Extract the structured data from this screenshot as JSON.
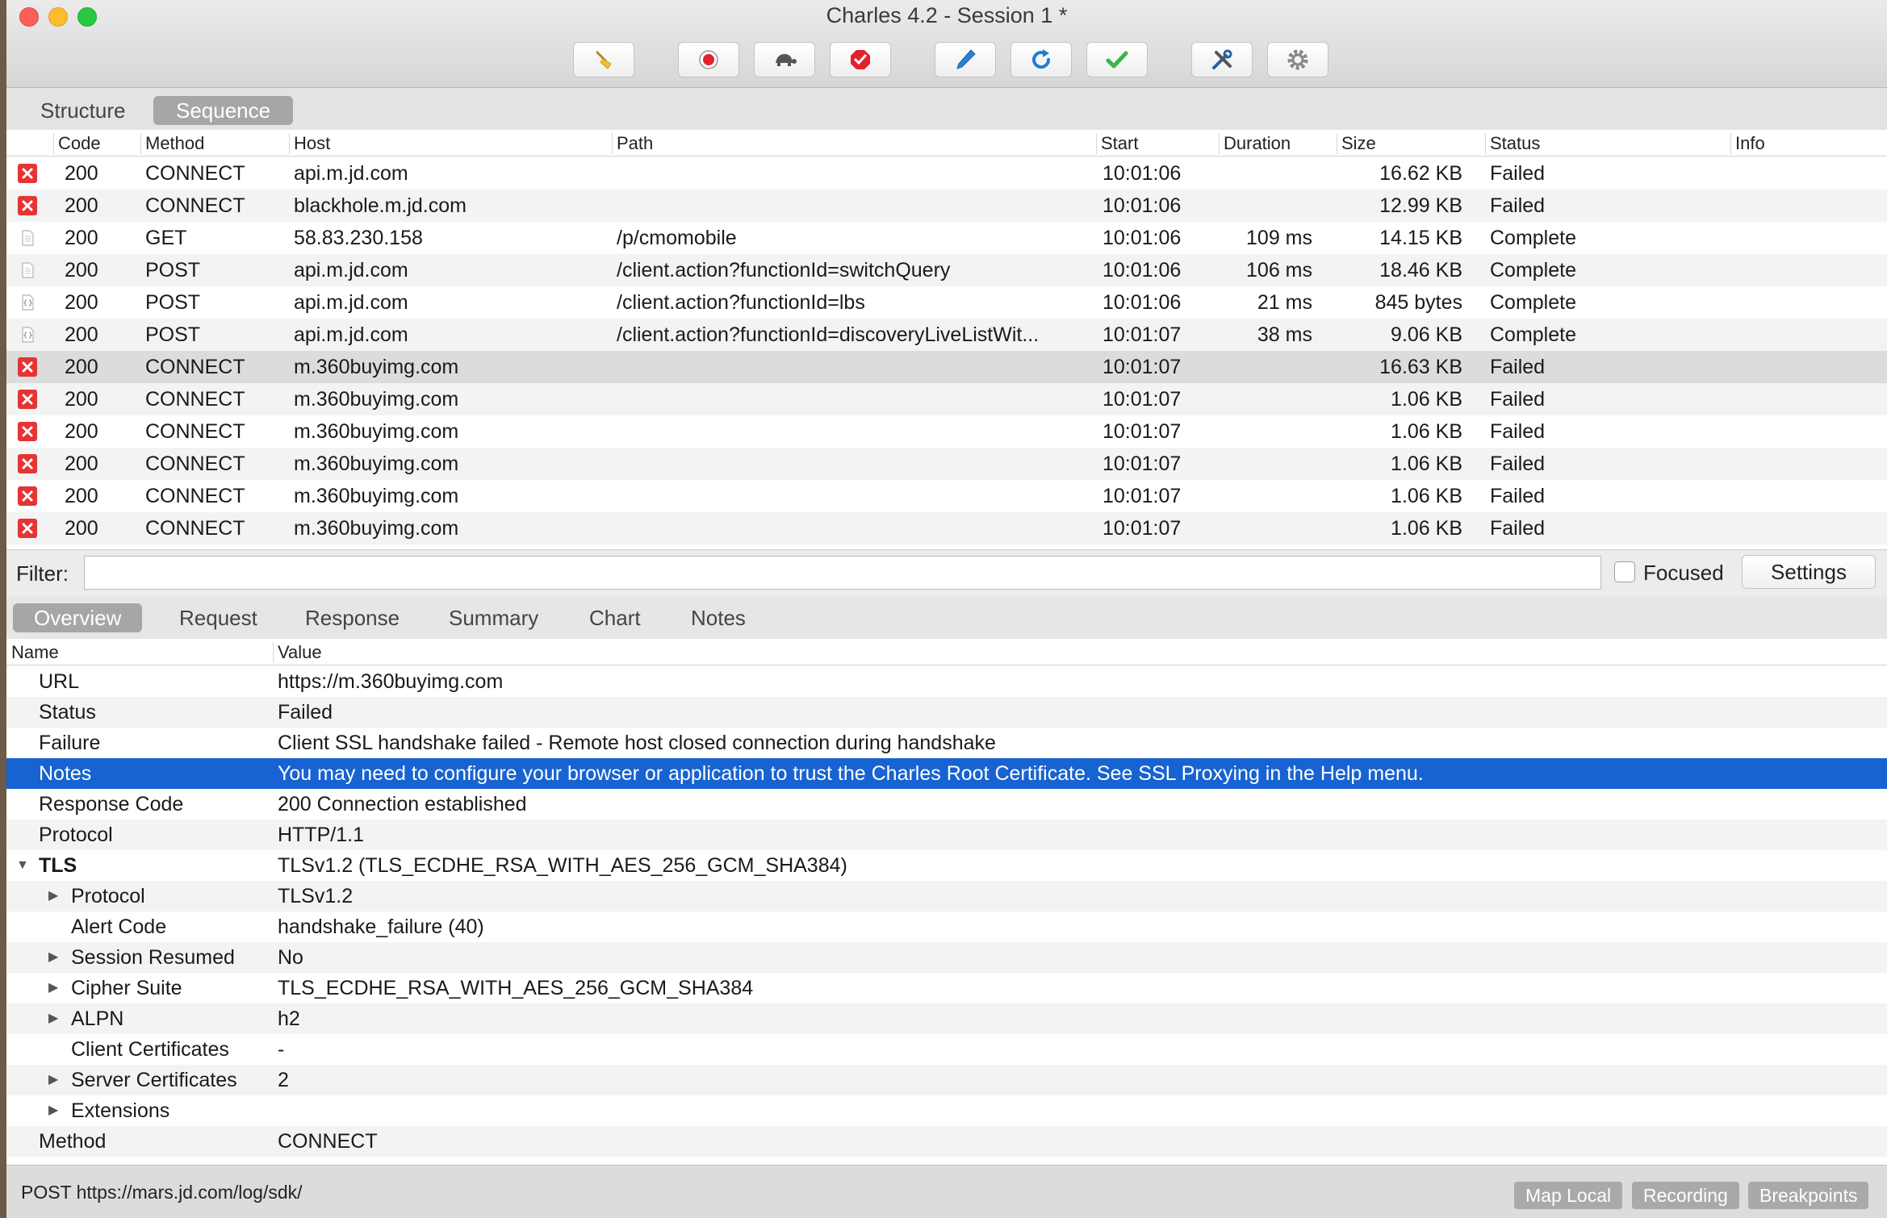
{
  "window": {
    "title": "Charles 4.2 - Session 1 *"
  },
  "toolbar": {
    "buttons": [
      {
        "icon": "broom-icon"
      },
      {
        "icon": "record-icon"
      },
      {
        "icon": "turtle-icon"
      },
      {
        "icon": "breakpoint-icon"
      },
      {
        "icon": "compose-pen-icon"
      },
      {
        "icon": "repeat-icon"
      },
      {
        "icon": "validate-checkmark-icon"
      },
      {
        "icon": "tools-icon"
      },
      {
        "icon": "gear-icon"
      }
    ]
  },
  "view_tabs": [
    {
      "label": "Structure",
      "active": false
    },
    {
      "label": "Sequence",
      "active": true
    }
  ],
  "sessions": {
    "columns": [
      "Code",
      "Method",
      "Host",
      "Path",
      "Start",
      "Duration",
      "Size",
      "Status",
      "Info"
    ],
    "rows": [
      {
        "icon": "failed",
        "code": "200",
        "method": "CONNECT",
        "host": "api.m.jd.com",
        "path": "",
        "start": "10:01:06",
        "duration": "",
        "size": "16.62 KB",
        "status": "Failed",
        "info": ""
      },
      {
        "icon": "failed",
        "code": "200",
        "method": "CONNECT",
        "host": "blackhole.m.jd.com",
        "path": "",
        "start": "10:01:06",
        "duration": "",
        "size": "12.99 KB",
        "status": "Failed",
        "info": ""
      },
      {
        "icon": "doc",
        "code": "200",
        "method": "GET",
        "host": "58.83.230.158",
        "path": "/p/cmomobile",
        "start": "10:01:06",
        "duration": "109 ms",
        "size": "14.15 KB",
        "status": "Complete",
        "info": ""
      },
      {
        "icon": "doc",
        "code": "200",
        "method": "POST",
        "host": "api.m.jd.com",
        "path": "/client.action?functionId=switchQuery",
        "start": "10:01:06",
        "duration": "106 ms",
        "size": "18.46 KB",
        "status": "Complete",
        "info": ""
      },
      {
        "icon": "json",
        "code": "200",
        "method": "POST",
        "host": "api.m.jd.com",
        "path": "/client.action?functionId=lbs",
        "start": "10:01:06",
        "duration": "21 ms",
        "size": "845 bytes",
        "status": "Complete",
        "info": ""
      },
      {
        "icon": "json",
        "code": "200",
        "method": "POST",
        "host": "api.m.jd.com",
        "path": "/client.action?functionId=discoveryLiveListWit...",
        "start": "10:01:07",
        "duration": "38 ms",
        "size": "9.06 KB",
        "status": "Complete",
        "info": ""
      },
      {
        "icon": "failed",
        "code": "200",
        "method": "CONNECT",
        "host": "m.360buyimg.com",
        "path": "",
        "start": "10:01:07",
        "duration": "",
        "size": "16.63 KB",
        "status": "Failed",
        "info": "",
        "selected": true
      },
      {
        "icon": "failed",
        "code": "200",
        "method": "CONNECT",
        "host": "m.360buyimg.com",
        "path": "",
        "start": "10:01:07",
        "duration": "",
        "size": "1.06 KB",
        "status": "Failed",
        "info": ""
      },
      {
        "icon": "failed",
        "code": "200",
        "method": "CONNECT",
        "host": "m.360buyimg.com",
        "path": "",
        "start": "10:01:07",
        "duration": "",
        "size": "1.06 KB",
        "status": "Failed",
        "info": ""
      },
      {
        "icon": "failed",
        "code": "200",
        "method": "CONNECT",
        "host": "m.360buyimg.com",
        "path": "",
        "start": "10:01:07",
        "duration": "",
        "size": "1.06 KB",
        "status": "Failed",
        "info": ""
      },
      {
        "icon": "failed",
        "code": "200",
        "method": "CONNECT",
        "host": "m.360buyimg.com",
        "path": "",
        "start": "10:01:07",
        "duration": "",
        "size": "1.06 KB",
        "status": "Failed",
        "info": ""
      },
      {
        "icon": "failed",
        "code": "200",
        "method": "CONNECT",
        "host": "m.360buyimg.com",
        "path": "",
        "start": "10:01:07",
        "duration": "",
        "size": "1.06 KB",
        "status": "Failed",
        "info": ""
      }
    ]
  },
  "filter": {
    "label": "Filter:",
    "value": "",
    "placeholder": "",
    "focused_label": "Focused",
    "focused_checked": false,
    "settings_label": "Settings"
  },
  "detail_tabs": [
    {
      "label": "Overview",
      "active": true
    },
    {
      "label": "Request",
      "active": false
    },
    {
      "label": "Response",
      "active": false
    },
    {
      "label": "Summary",
      "active": false
    },
    {
      "label": "Chart",
      "active": false
    },
    {
      "label": "Notes",
      "active": false
    }
  ],
  "overview": {
    "columns": [
      "Name",
      "Value"
    ],
    "rows": [
      {
        "name": "URL",
        "value": "https://m.360buyimg.com",
        "level": 0,
        "toggle": "none"
      },
      {
        "name": "Status",
        "value": "Failed",
        "level": 0,
        "toggle": "none"
      },
      {
        "name": "Failure",
        "value": "Client SSL handshake failed - Remote host closed connection during handshake",
        "level": 0,
        "toggle": "none"
      },
      {
        "name": "Notes",
        "value": "You may need to configure your browser or application to trust the Charles Root Certificate. See SSL Proxying in the Help menu.",
        "level": 0,
        "toggle": "none",
        "highlight": true
      },
      {
        "name": "Response Code",
        "value": "200 Connection established",
        "level": 0,
        "toggle": "none"
      },
      {
        "name": "Protocol",
        "value": "HTTP/1.1",
        "level": 0,
        "toggle": "none"
      },
      {
        "name": "TLS",
        "value": "TLSv1.2 (TLS_ECDHE_RSA_WITH_AES_256_GCM_SHA384)",
        "level": 0,
        "toggle": "expanded",
        "bold": true
      },
      {
        "name": "Protocol",
        "value": "TLSv1.2",
        "level": 1,
        "toggle": "collapsed"
      },
      {
        "name": "Alert Code",
        "value": "handshake_failure (40)",
        "level": 1,
        "toggle": "none"
      },
      {
        "name": "Session Resumed",
        "value": "No",
        "level": 1,
        "toggle": "collapsed"
      },
      {
        "name": "Cipher Suite",
        "value": "TLS_ECDHE_RSA_WITH_AES_256_GCM_SHA384",
        "level": 1,
        "toggle": "collapsed"
      },
      {
        "name": "ALPN",
        "value": "h2",
        "level": 1,
        "toggle": "collapsed"
      },
      {
        "name": "Client Certificates",
        "value": "-",
        "level": 1,
        "toggle": "none"
      },
      {
        "name": "Server Certificates",
        "value": "2",
        "level": 1,
        "toggle": "collapsed"
      },
      {
        "name": "Extensions",
        "value": "",
        "level": 1,
        "toggle": "collapsed"
      },
      {
        "name": "Method",
        "value": "CONNECT",
        "level": 0,
        "toggle": "none"
      }
    ]
  },
  "statusbar": {
    "text": "POST https://mars.jd.com/log/sdk/",
    "buttons": [
      "Map Local",
      "Recording",
      "Breakpoints"
    ]
  }
}
